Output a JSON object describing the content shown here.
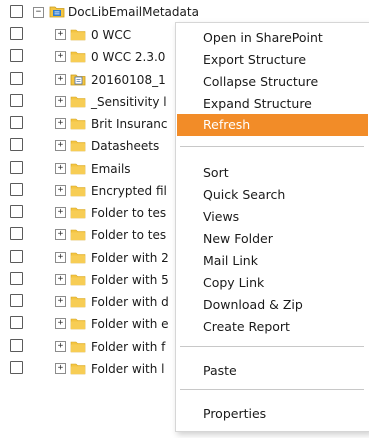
{
  "tree": {
    "root_label": "DocLibEmailMetadata",
    "items": [
      {
        "label": "0 WCC",
        "icon": "folder-icon"
      },
      {
        "label": "0 WCC 2.3.0",
        "icon": "folder-icon"
      },
      {
        "label": "20160108_1",
        "icon": "document-set-icon"
      },
      {
        "label": "_Sensitivity l",
        "icon": "folder-icon"
      },
      {
        "label": "Brit Insuranc",
        "icon": "folder-icon"
      },
      {
        "label": "Datasheets",
        "icon": "folder-icon"
      },
      {
        "label": "Emails",
        "icon": "folder-icon"
      },
      {
        "label": "Encrypted fil",
        "icon": "folder-icon"
      },
      {
        "label": "Folder to tes",
        "icon": "folder-icon"
      },
      {
        "label": "Folder to tes",
        "icon": "folder-icon"
      },
      {
        "label": "Folder with 2",
        "icon": "folder-icon"
      },
      {
        "label": "Folder with 5",
        "icon": "folder-icon"
      },
      {
        "label": "Folder with d",
        "icon": "folder-icon"
      },
      {
        "label": "Folder with e",
        "icon": "folder-icon"
      },
      {
        "label": "Folder with f",
        "icon": "folder-icon"
      },
      {
        "label": "Folder with l",
        "icon": "folder-icon"
      }
    ]
  },
  "context_menu": {
    "group1": [
      "Open in SharePoint",
      "Export Structure",
      "Collapse Structure",
      "Expand Structure",
      "Refresh"
    ],
    "group2": [
      "Sort",
      "Quick Search",
      "Views",
      "New Folder",
      "Mail Link",
      "Copy Link",
      "Download & Zip",
      "Create Report"
    ],
    "group3": [
      "Paste"
    ],
    "group4": [
      "Properties"
    ],
    "highlighted": "Refresh"
  },
  "colors": {
    "highlight": "#f28c28",
    "folder": "#f4c542"
  }
}
